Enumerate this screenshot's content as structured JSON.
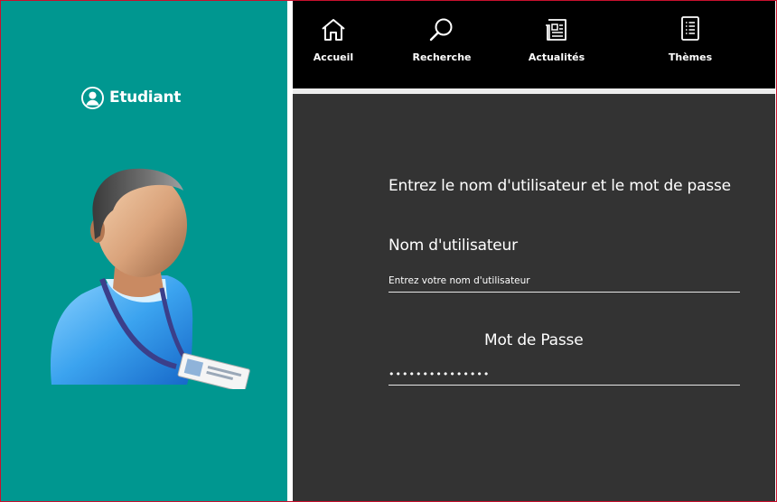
{
  "sidebar": {
    "role_label": "Etudiant",
    "role_icon": "user-circle-icon",
    "avatar_image": "student-with-badge-avatar"
  },
  "nav": {
    "items": [
      {
        "label": "Accueil",
        "icon": "home-icon"
      },
      {
        "label": "Recherche",
        "icon": "search-icon"
      },
      {
        "label": "Actualités",
        "icon": "newspaper-icon"
      },
      {
        "label": "Thèmes",
        "icon": "document-list-icon"
      }
    ]
  },
  "login": {
    "heading": "Entrez le nom d'utilisateur et le mot de passe",
    "username_label": "Nom d'utilisateur",
    "username_placeholder": "Entrez votre nom d'utilisateur",
    "username_value": "",
    "password_label": "Mot de Passe",
    "password_value": "•••••••••••••••"
  },
  "colors": {
    "sidebar_bg": "#009790",
    "topbar_bg": "#000000",
    "form_bg": "#333333",
    "window_border": "#c8102e"
  }
}
